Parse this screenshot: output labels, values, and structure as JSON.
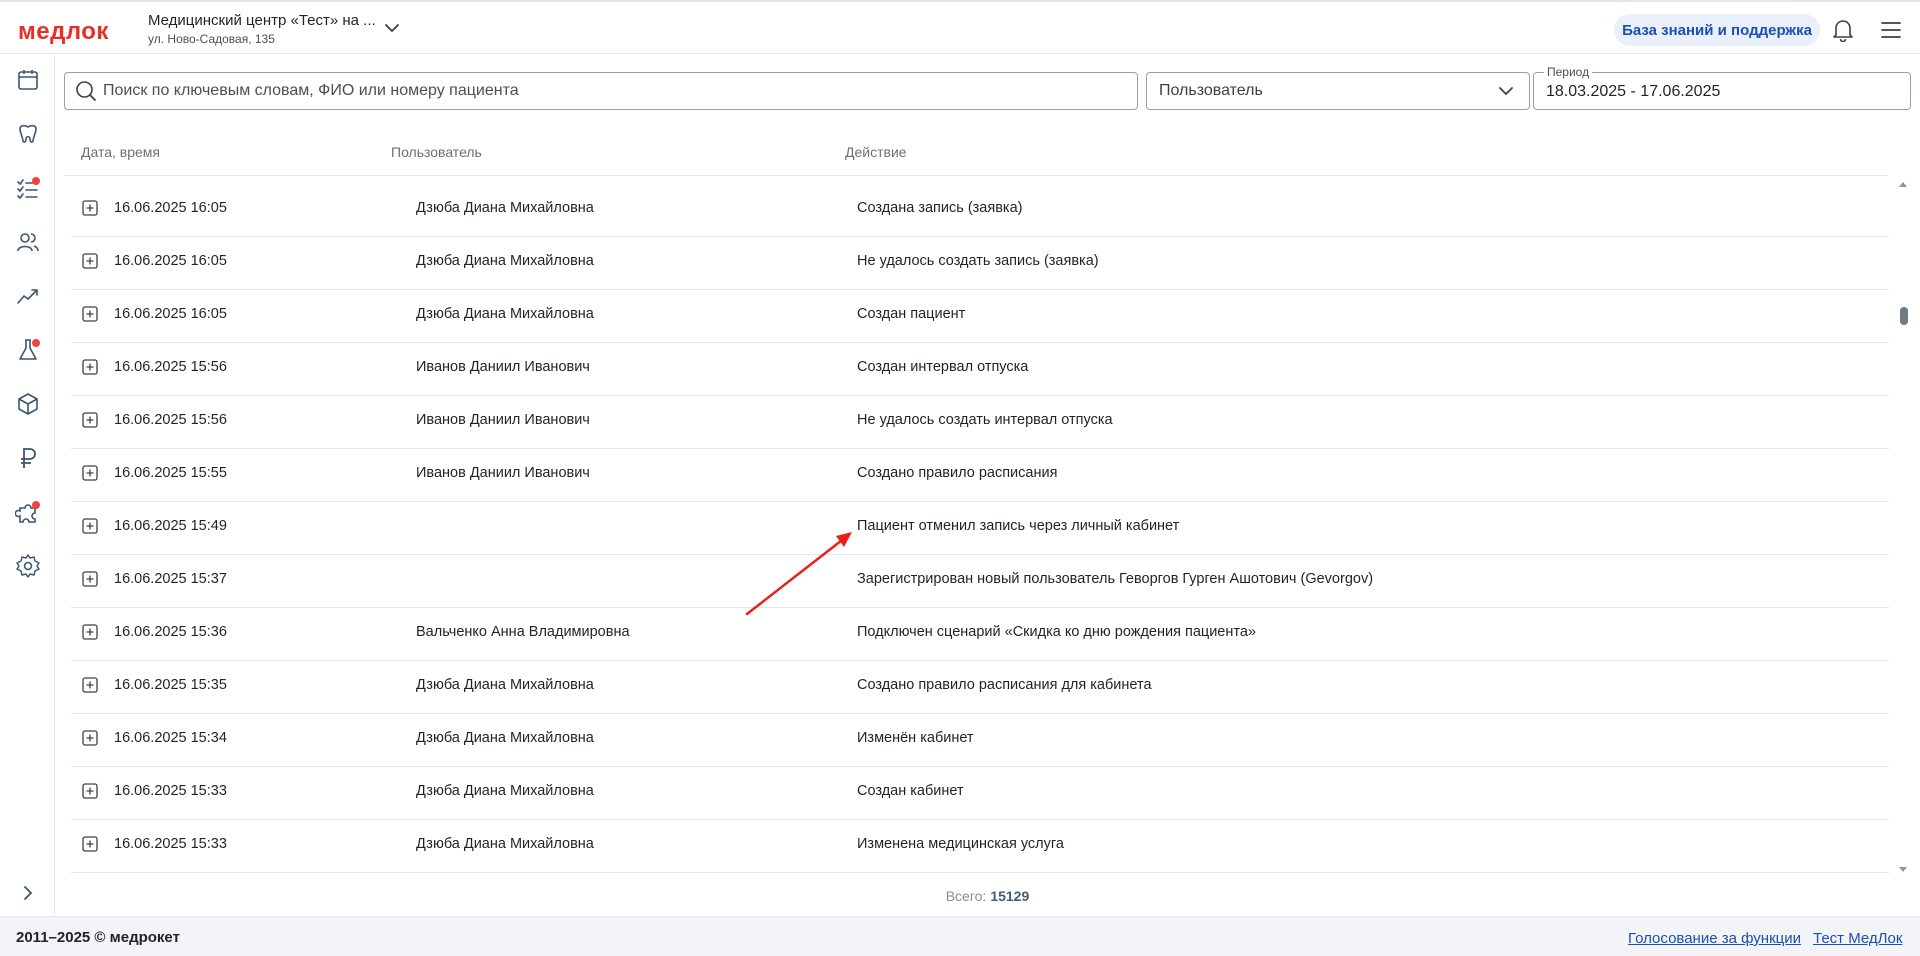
{
  "header": {
    "logo": "медлок",
    "org_name": "Медицинский центр «Тест» на ...",
    "org_address": "ул. Ново-Садовая, 135",
    "kb_button": "База знаний и поддержка"
  },
  "sidebar": {
    "items": [
      {
        "icon": "calendar-icon",
        "badge": false
      },
      {
        "icon": "tooth-icon",
        "badge": false
      },
      {
        "icon": "checklist-icon",
        "badge": true
      },
      {
        "icon": "users-icon",
        "badge": false
      },
      {
        "icon": "chart-icon",
        "badge": false
      },
      {
        "icon": "flask-icon",
        "badge": true
      },
      {
        "icon": "box-icon",
        "badge": false
      },
      {
        "icon": "ruble-icon",
        "badge": false
      },
      {
        "icon": "puzzle-icon",
        "badge": true
      },
      {
        "icon": "gear-icon",
        "badge": false
      }
    ]
  },
  "filters": {
    "search_placeholder": "Поиск по ключевым словам, ФИО или номеру пациента",
    "user_select": "Пользователь",
    "period_label": "Период",
    "period_value": "18.03.2025 - 17.06.2025"
  },
  "table": {
    "columns": [
      "Дата, время",
      "Пользователь",
      "Действие"
    ],
    "rows": [
      {
        "datetime": "16.06.2025 16:05",
        "user": "Дзюба Диана Михайловна",
        "action": "Создана запись (заявка)"
      },
      {
        "datetime": "16.06.2025 16:05",
        "user": "Дзюба Диана Михайловна",
        "action": "Не удалось создать запись (заявка)"
      },
      {
        "datetime": "16.06.2025 16:05",
        "user": "Дзюба Диана Михайловна",
        "action": "Создан пациент"
      },
      {
        "datetime": "16.06.2025 15:56",
        "user": "Иванов Даниил Иванович",
        "action": "Создан интервал отпуска"
      },
      {
        "datetime": "16.06.2025 15:56",
        "user": "Иванов Даниил Иванович",
        "action": "Не удалось создать интервал отпуска"
      },
      {
        "datetime": "16.06.2025 15:55",
        "user": "Иванов Даниил Иванович",
        "action": "Создано правило расписания"
      },
      {
        "datetime": "16.06.2025 15:49",
        "user": "",
        "action": "Пациент отменил запись через личный кабинет"
      },
      {
        "datetime": "16.06.2025 15:37",
        "user": "",
        "action": "Зарегистрирован новый пользователь Геворгов Гурген Ашотович (Gevorgov)"
      },
      {
        "datetime": "16.06.2025 15:36",
        "user": "Вальченко Анна Владимировна",
        "action": "Подключен сценарий «Скидка ко дню рождения пациента»"
      },
      {
        "datetime": "16.06.2025 15:35",
        "user": "Дзюба Диана Михайловна",
        "action": "Создано правило расписания для кабинета"
      },
      {
        "datetime": "16.06.2025 15:34",
        "user": "Дзюба Диана Михайловна",
        "action": "Изменён кабинет"
      },
      {
        "datetime": "16.06.2025 15:33",
        "user": "Дзюба Диана Михайловна",
        "action": "Создан кабинет"
      },
      {
        "datetime": "16.06.2025 15:33",
        "user": "Дзюба Диана Михайловна",
        "action": "Изменена медицинская услуга"
      }
    ],
    "total_label": "Всего:",
    "total_value": "15129"
  },
  "footer": {
    "copyright": "2011–2025 © медрокет",
    "link_vote": "Голосование за функции",
    "link_test": "Тест МедЛок"
  },
  "colors": {
    "brand_red": "#e63026",
    "link_blue": "#1b4fb3",
    "badge_red": "#f0453c",
    "annotation_arrow": "#e8201a"
  }
}
